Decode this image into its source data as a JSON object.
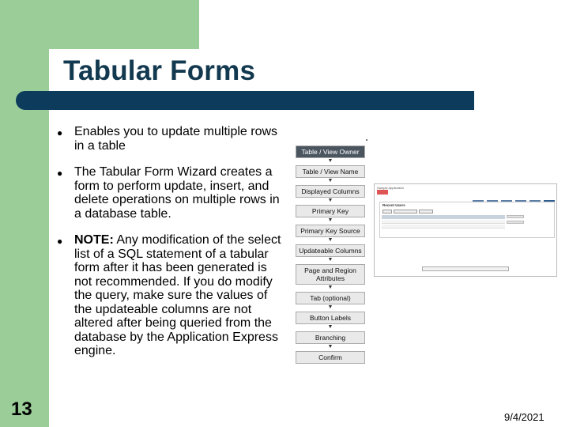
{
  "slide": {
    "title": "Tabular Forms",
    "page_number": "13",
    "date": "9/4/2021"
  },
  "bullets": [
    {
      "prefix": "",
      "text": "Enables you to update multiple rows in a table"
    },
    {
      "prefix": "",
      "text": "The Tabular Form Wizard creates a form to perform update, insert, and delete operations on multiple rows in a database table."
    },
    {
      "prefix": "NOTE:",
      "text": " Any modification of the select list of a SQL statement of a tabular form after it has been generated is not recommended. If you do modify the query, make sure the values of the updateable columns are not altered after being queried from the database by the Application Express engine."
    }
  ],
  "wizard_steps": [
    "Table / View Owner",
    "Table / View Name",
    "Displayed Columns",
    "Primary Key",
    "Primary Key Source",
    "Updateable Columns",
    "Page and Region Attributes",
    "Tab (optional)",
    "Button Labels",
    "Branching",
    "Confirm"
  ],
  "wizard_active_step": 0,
  "screenshot": {
    "app_label": "Sample Application",
    "region_title": "Recent Users"
  }
}
